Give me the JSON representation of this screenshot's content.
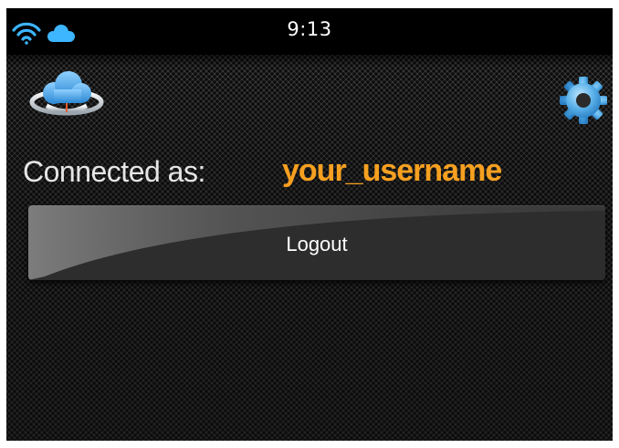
{
  "status_bar": {
    "time": "9:13",
    "icons": [
      "wifi-icon",
      "cloud-icon"
    ]
  },
  "header": {
    "logo_icon": "cloud-sync-icon",
    "settings_icon": "gear-icon"
  },
  "account": {
    "connected_label": "Connected as:",
    "username": "your_username"
  },
  "actions": {
    "logout_label": "Logout"
  },
  "colors": {
    "username_accent": "#f7a020",
    "icon_blue": "#4aa3df",
    "background": "#282828"
  }
}
